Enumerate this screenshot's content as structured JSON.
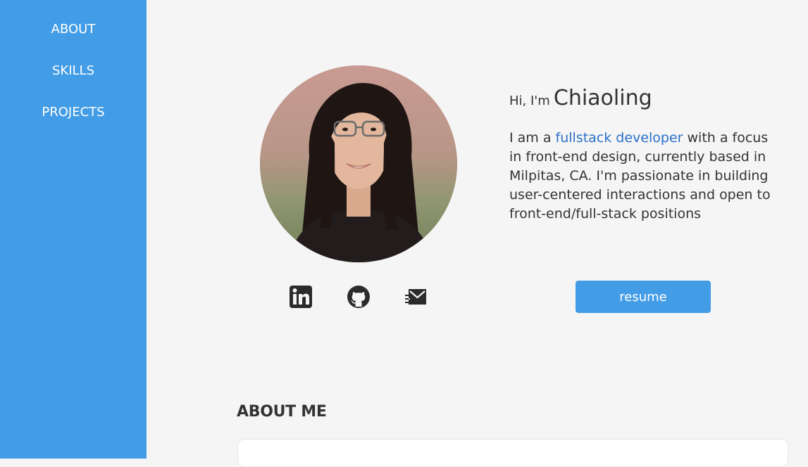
{
  "nav": {
    "items": [
      {
        "label": "ABOUT"
      },
      {
        "label": "SKILLS"
      },
      {
        "label": "PROJECTS"
      }
    ]
  },
  "hero": {
    "greeting_prefix": "Hi, I'm",
    "name": "Chiaoling",
    "intro_before": "I am a",
    "intro_highlight": "fullstack developer",
    "intro_after": "with a focus in front-end design, currently based in Milpitas, CA. I'm passionate in building user-centered interactions and open to front-end/full-stack positions",
    "resume_label": "resume"
  },
  "social": [
    {
      "icon": "linkedin-icon"
    },
    {
      "icon": "github-icon"
    },
    {
      "icon": "email-icon"
    }
  ],
  "about": {
    "title": "ABOUT ME"
  },
  "colors": {
    "accent": "#439ce6",
    "link": "#2a6fc9",
    "background": "#f5f5f5",
    "text": "#333333"
  }
}
